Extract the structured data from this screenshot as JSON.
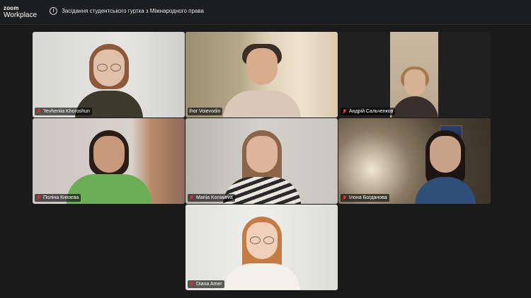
{
  "app": {
    "brand_line1": "zoom",
    "brand_line2": "Workplace"
  },
  "meeting": {
    "title": "Засідання студентського гуртка з Міжнародного права"
  },
  "participants": [
    {
      "name": "Yevheniia Khoroshun"
    },
    {
      "name": "Ihor Voievodin",
      "active_speaker": true
    },
    {
      "name": "Андрій Сальченков"
    },
    {
      "name": "Поліна Князєва"
    },
    {
      "name": "Mariia Koniaieva"
    },
    {
      "name": "Ілона Богданова"
    },
    {
      "name": "Diana Amer"
    }
  ],
  "colors": {
    "active_border": "#37d37b",
    "muted_icon": "#e2312c",
    "background": "#1a1a1a"
  }
}
